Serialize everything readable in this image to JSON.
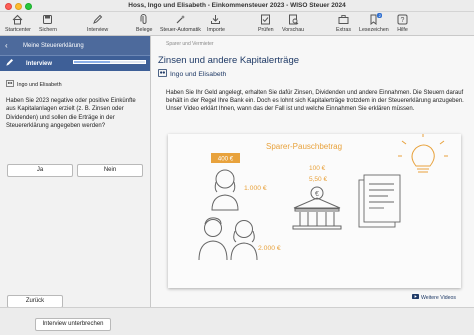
{
  "window": {
    "title": "Hoss, Ingo und Elisabeth - Einkommensteuer 2023 - WISO Steuer 2024"
  },
  "toolbar": {
    "startcenter": "Startcenter",
    "sichern": "Sichern",
    "interview": "Interview",
    "belege": "Belege",
    "steuer_automatik": "Steuer-Automatik",
    "importe": "Importe",
    "pruefen": "Prüfen",
    "vorschau": "Vorschau",
    "extras": "Extras",
    "lesezeichen": "Lesezeichen",
    "lesezeichen_badge": "2",
    "hilfe": "Hilfe"
  },
  "sidebar": {
    "header": "Meine Steuererklärung",
    "tab": "Interview",
    "progress": 0.5,
    "persons": "Ingo und Elisabeth",
    "question": "Haben Sie 2023 negative oder positive Einkünfte aus Kapitalanlagen erzielt (z. B. Zinsen oder Dividenden) und sollen die Erträge in der Steuererklärung angegeben werden?",
    "ja": "Ja",
    "nein": "Nein",
    "zurueck": "Zurück"
  },
  "main": {
    "breadcrumb": "Sparer und Vermieter",
    "title": "Zinsen und andere Kapitalerträge",
    "persons": "Ingo und Elisabeth",
    "intro": "Haben Sie Ihr Geld angelegt, erhalten Sie dafür Zinsen, Dividenden und andere Einnahmen. Die Steuern darauf behält in der Regel Ihre Bank ein. Doch es lohnt sich Kapitalerträge trotzdem in der Steuererklärung anzugeben. Unser Video erklärt Ihnen, wann das der Fall ist und welche Einnahmen Sie erklären müssen.",
    "video": {
      "heading": "Sparer-Pauschbetrag",
      "amount_1": "400 €",
      "amount_2": "1.000 €",
      "amount_3": "100 €",
      "amount_4": "5,50 €",
      "amount_5": "2.000 €",
      "coin_symbol": "€"
    },
    "more_videos": "Weitere Videos"
  },
  "footer": {
    "abort": "Interview unterbrechen"
  },
  "colors": {
    "accent": "#3e5f97",
    "video_orange": "#e8a23c",
    "title_blue": "#1f3a66"
  }
}
